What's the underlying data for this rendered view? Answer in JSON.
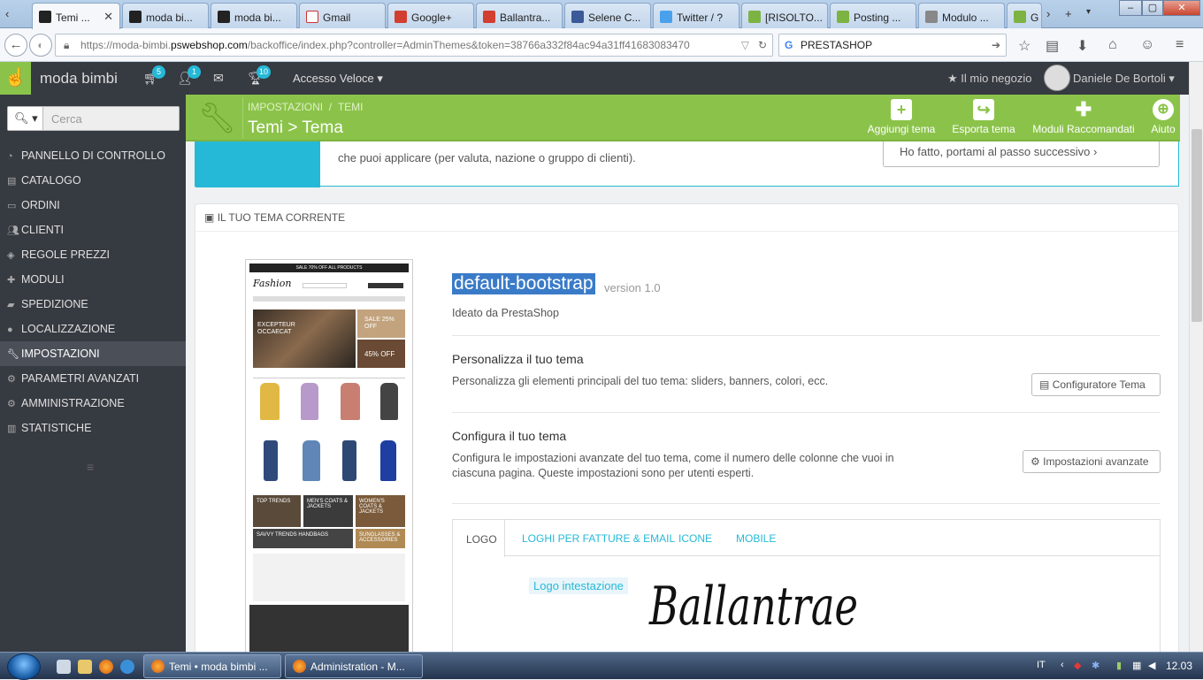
{
  "browser": {
    "tabs": [
      {
        "label": "Temi ...",
        "active": true
      },
      {
        "label": "moda bi..."
      },
      {
        "label": "moda bi..."
      },
      {
        "label": "Gmail"
      },
      {
        "label": "Google+"
      },
      {
        "label": "Ballantra..."
      },
      {
        "label": "Selene C..."
      },
      {
        "label": "Twitter / ?"
      },
      {
        "label": "[RISOLTO..."
      },
      {
        "label": "Posting ..."
      },
      {
        "label": "Modulo ..."
      },
      {
        "label": "G"
      }
    ],
    "url_prefix": "https://moda-bimbi.",
    "url_domain": "pswebshop.com",
    "url_rest": "/backoffice/index.php?controller=AdminThemes&token=38766a332f84ac94a31ff41683083470",
    "search_value": "PRESTASHOP"
  },
  "header": {
    "shop_name": "moda bimbi",
    "badges": {
      "orders": "5",
      "customers": "1",
      "achievements": "10"
    },
    "quick_access": "Accesso Veloce",
    "my_shop": "Il mio negozio",
    "user": "Daniele De Bortoli"
  },
  "sidebar": {
    "search_placeholder": "Cerca",
    "items": [
      {
        "label": "PANNELLO DI CONTROLLO",
        "icon": "dashboard-icon"
      },
      {
        "label": "CATALOGO",
        "icon": "book-icon"
      },
      {
        "label": "ORDINI",
        "icon": "credit-card-icon"
      },
      {
        "label": "CLIENTI",
        "icon": "users-icon"
      },
      {
        "label": "REGOLE PREZZI",
        "icon": "tag-icon"
      },
      {
        "label": "MODULI",
        "icon": "puzzle-icon"
      },
      {
        "label": "SPEDIZIONE",
        "icon": "truck-icon"
      },
      {
        "label": "LOCALIZZAZIONE",
        "icon": "globe-icon"
      },
      {
        "label": "IMPOSTAZIONI",
        "icon": "wrench-icon",
        "active": true
      },
      {
        "label": "PARAMETRI AVANZATI",
        "icon": "cogs-icon"
      },
      {
        "label": "AMMINISTRAZIONE",
        "icon": "cog-icon"
      },
      {
        "label": "STATISTICHE",
        "icon": "bar-chart-icon"
      }
    ]
  },
  "toolbar": {
    "breadcrumb_1": "IMPOSTAZIONI",
    "breadcrumb_sep": "/",
    "breadcrumb_2": "TEMI",
    "title": "Temi > Tema",
    "buttons": {
      "add": "Aggiungi tema",
      "export": "Esporta tema",
      "modules": "Moduli Raccomandati",
      "help": "Aiuto"
    }
  },
  "alert": {
    "text": "che puoi applicare (per valuta, nazione o gruppo di clienti).",
    "button": "Ho fatto, portami al passo successivo"
  },
  "panel": {
    "heading": "IL TUO TEMA CORRENTE",
    "theme_name": "default-bootstrap",
    "version": "version 1.0",
    "designer": "Ideato da PrestaShop",
    "customize_title": "Personalizza il tuo tema",
    "customize_desc": "Personalizza gli elementi principali del tuo tema: sliders, banners, colori, ecc.",
    "configurator_button": "Configuratore Tema",
    "configure_title": "Configura il tuo tema",
    "configure_desc_1": "Configura le impostazioni avanzate del tuo tema, come il numero delle colonne che vuoi in",
    "configure_desc_2": "ciascuna pagina. Queste impostazioni sono per utenti esperti.",
    "advanced_button": "Impostazioni avanzate",
    "tabs": [
      "LOGO",
      "LOGHI PER FATTURE & EMAIL",
      "ICONE",
      "MOBILE"
    ],
    "logo_label": "Logo intestazione",
    "logo_text": "Ballantrae"
  },
  "preview": {
    "banner": "SALE 70% OFF ALL PRODUCTS",
    "brand": "Fashion",
    "hero": "EXCEPTEUR OCCAECAT",
    "sale_1": "SALE 25% OFF",
    "sale_2": "45% OFF",
    "tiles": [
      "TOP TRENDS",
      "MEN'S COATS & JACKETS",
      "WOMEN'S COATS & JACKETS",
      "SAVVY TRENDS HANDBAGS",
      "SUNGLASSES & ACCESSORIES"
    ]
  },
  "taskbar": {
    "items": [
      "Temi • moda bimbi ...",
      "Administration - M..."
    ],
    "lang": "IT",
    "clock": "12.03"
  },
  "colors": {
    "brand_green": "#8bc34a",
    "sidebar": "#363a41",
    "accent_blue": "#25b9d7"
  }
}
